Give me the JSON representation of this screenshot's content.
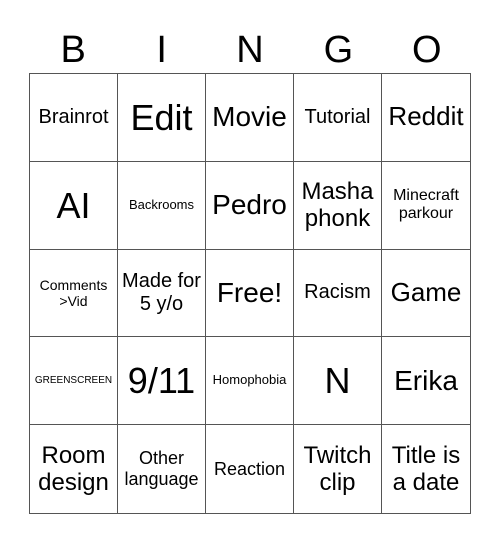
{
  "header": {
    "letters": [
      "B",
      "I",
      "N",
      "G",
      "O"
    ]
  },
  "cells": [
    "Brainrot",
    "Edit",
    "Movie",
    "Tutorial",
    "Reddit",
    "AI",
    "Backrooms",
    "Pedro",
    "Masha phonk",
    "Minecraft parkour",
    "Comments >Vid",
    "Made for 5 y/o",
    "Free!",
    "Racism",
    "Game",
    "GREENSCREEN",
    "9/11",
    "Homophobia",
    "N",
    "Erika",
    "Room design",
    "Other language",
    "Reaction",
    "Twitch clip",
    "Title is a date"
  ]
}
